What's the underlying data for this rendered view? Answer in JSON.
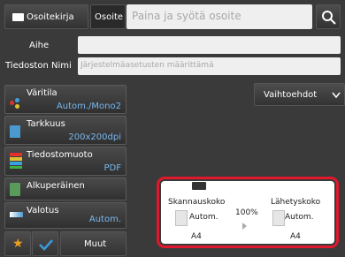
{
  "top": {
    "address_book": "Osoitekirja",
    "address_tab": "Osoite",
    "address_placeholder": "Paina ja syötä osoite"
  },
  "fields": {
    "subject_label": "Aihe",
    "filename_label": "Tiedoston Nimi",
    "filename_placeholder": "Järjestelmäasetusten määrittämä"
  },
  "options_button": "Vaihtoehdot",
  "menu": [
    {
      "title": "Väritila",
      "value": "Autom./Mono2"
    },
    {
      "title": "Tarkkuus",
      "value": "200x200dpi"
    },
    {
      "title": "Tiedostomuoto",
      "value": "PDF"
    },
    {
      "title": "Alkuperäinen",
      "value": ""
    },
    {
      "title": "Valotus",
      "value": "Autom."
    }
  ],
  "bottom": {
    "others": "Muut"
  },
  "panel": {
    "scan_size_label": "Skannauskoko",
    "scan_size_value": "Autom.",
    "scan_paper": "A4",
    "ratio": "100%",
    "send_size_label": "Lähetyskoko",
    "send_size_value": "Autom.",
    "send_paper": "A4"
  },
  "colors": {
    "accent_blue": "#78b8f0",
    "highlight_red": "#e0182d",
    "star": "#f0a020",
    "check": "#3a9ad9"
  },
  "icons": [
    "address-book-icon",
    "search-icon",
    "chevron-down-icon",
    "color-mode-icon",
    "resolution-icon",
    "file-format-icon",
    "original-icon",
    "exposure-icon",
    "star-icon",
    "check-icon",
    "arrow-right-icon",
    "scanner-icon",
    "document-icon"
  ]
}
